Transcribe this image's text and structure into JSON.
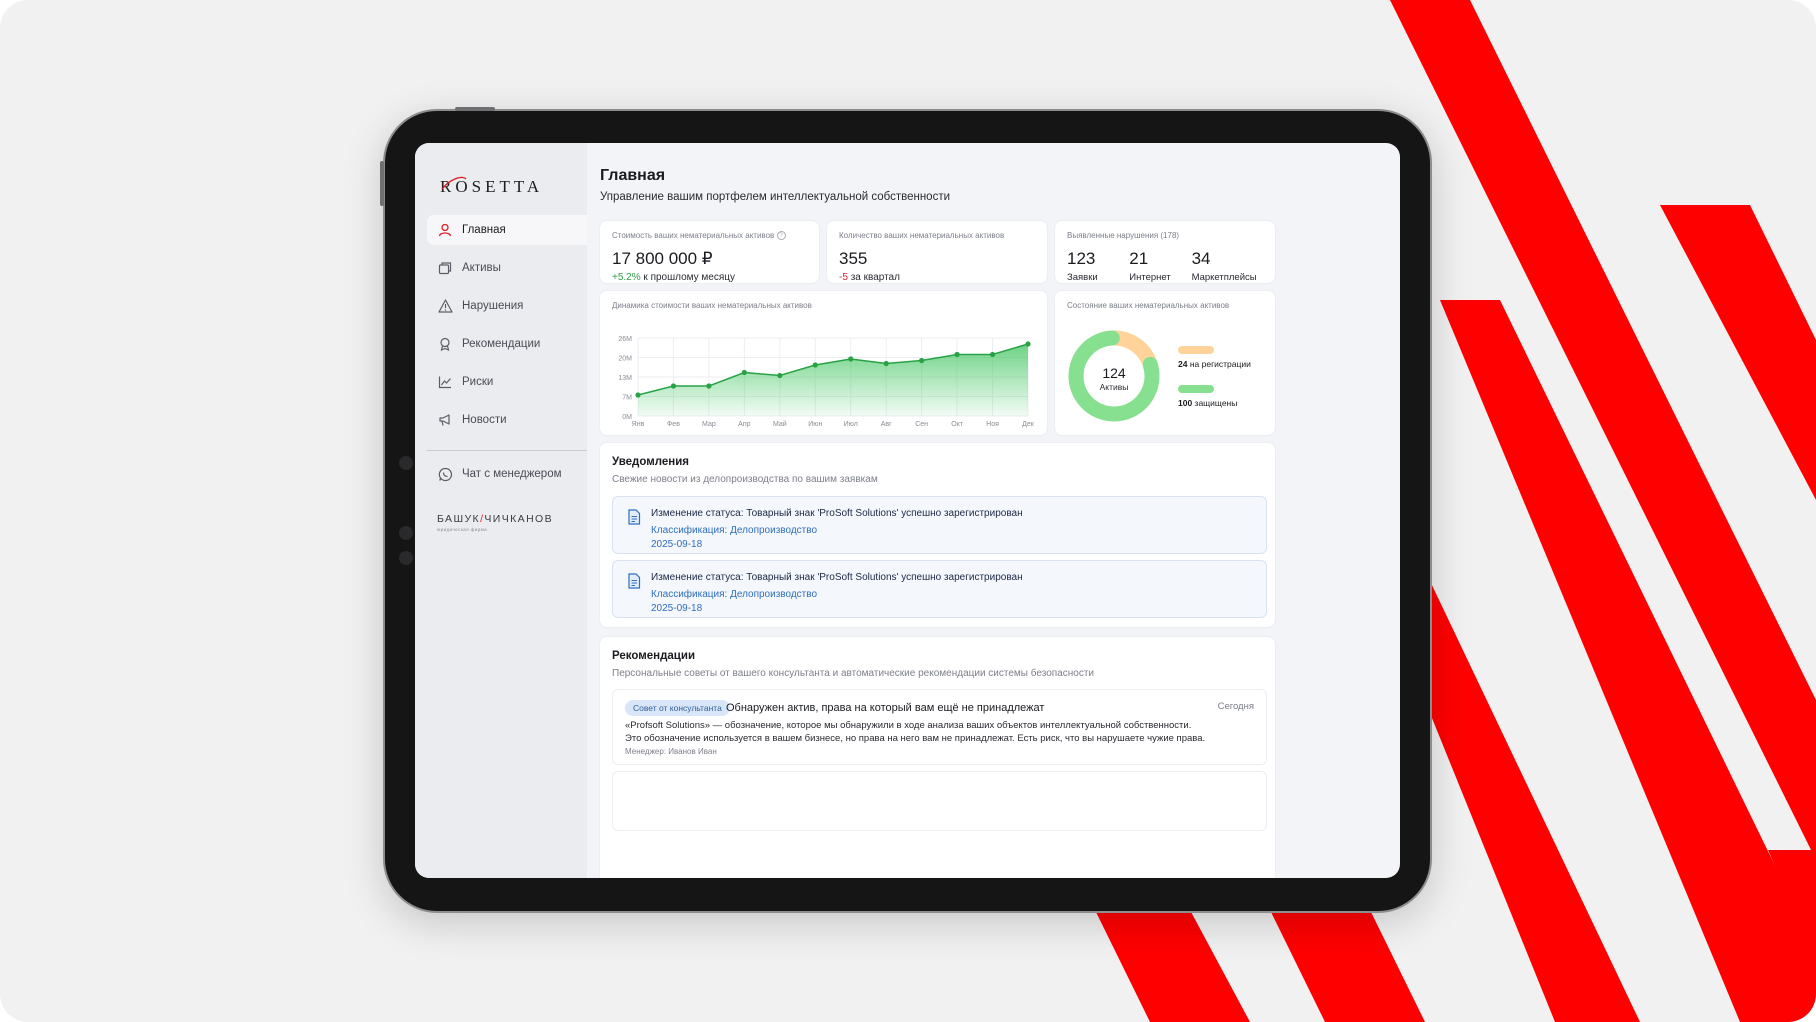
{
  "brand": {
    "logo": "ROSETTA",
    "partner_name_left": "БАШУК",
    "partner_slash": "/",
    "partner_name_right": "ЧИЧКАНОВ",
    "partner_sub": "юридическая фирма"
  },
  "sidebar": {
    "items": [
      {
        "label": "Главная",
        "icon": "user-icon",
        "active": true
      },
      {
        "label": "Активы",
        "icon": "stack-icon",
        "active": false
      },
      {
        "label": "Нарушения",
        "icon": "warning-icon",
        "active": false
      },
      {
        "label": "Рекомендации",
        "icon": "award-icon",
        "active": false
      },
      {
        "label": "Риски",
        "icon": "chart-line-icon",
        "active": false
      },
      {
        "label": "Новости",
        "icon": "megaphone-icon",
        "active": false
      }
    ],
    "chat_label": "Чат с менеджером"
  },
  "header": {
    "title": "Главная",
    "subtitle": "Управление вашим портфелем интеллектуальной собственности"
  },
  "kpis": {
    "value": {
      "label": "Стоимость ваших нематериальных активов",
      "amount": "17 800 000 ₽",
      "delta": "+5.2%",
      "delta_text": "к прошлому месяцу"
    },
    "count": {
      "label": "Количество ваших нематериальных активов",
      "amount": "355",
      "delta": "-5",
      "delta_text": "за квартал"
    },
    "violations": {
      "label": "Выявленные нарушения (178)",
      "items": [
        {
          "num": "123",
          "label": "Заявки"
        },
        {
          "num": "21",
          "label": "Интернет"
        },
        {
          "num": "34",
          "label": "Маркетплейсы"
        }
      ]
    }
  },
  "chart_data": [
    {
      "type": "area",
      "title": "Динамика стоимости ваших нематериальных активов",
      "categories": [
        "Янв",
        "Фев",
        "Мар",
        "Апр",
        "Май",
        "Июн",
        "Июл",
        "Авг",
        "Сен",
        "Окт",
        "Ноя",
        "Дек"
      ],
      "values": [
        7,
        10,
        10,
        14.5,
        13.5,
        17,
        19,
        17.5,
        18.5,
        20.5,
        20.5,
        24
      ],
      "y_ticks": [
        "0M",
        "7M",
        "13M",
        "20M",
        "26M"
      ],
      "ylim": [
        0,
        26
      ],
      "grid": true,
      "color": "#27a244"
    },
    {
      "type": "pie",
      "title": "Состояние ваших нематериальных активов",
      "center_value": "124",
      "center_label": "Активы",
      "slices": [
        {
          "value": 24,
          "label": "на регистрации",
          "color": "#ffd399"
        },
        {
          "value": 100,
          "label": "защищены",
          "color": "#86e08f"
        }
      ]
    }
  ],
  "notifications": {
    "title": "Уведомления",
    "subtitle": "Свежие новости из делопроизводства по вашим заявкам",
    "items": [
      {
        "title": "Изменение статуса: Товарный знак 'ProSoft Solutions' успешно зарегистрирован",
        "classification": "Классификация: Делопроизводство",
        "date": "2025-09-18"
      },
      {
        "title": "Изменение статуса: Товарный знак 'ProSoft Solutions' успешно зарегистрирован",
        "classification": "Классификация: Делопроизводство",
        "date": "2025-09-18"
      }
    ]
  },
  "recommendations": {
    "title": "Рекомендации",
    "subtitle": "Персональные советы от вашего консультанта и автоматические рекомендации системы безопасности",
    "items": [
      {
        "badge": "Совет от консультанта",
        "title": "Обнаружен актив, права на который вам ещё не принадлежат",
        "when": "Сегодня",
        "line1": "«Profsoft Solutions» — обозначение, которое мы обнаружили в ходе анализа ваших объектов интеллектуальной собственности.",
        "line2": "Это обозначение используется в вашем бизнесе, но права на него вам не принадлежат. Есть риск, что вы нарушаете чужие права.",
        "manager": "Менеджер: Иванов Иван"
      }
    ]
  },
  "colors": {
    "brand_red": "#ff0000",
    "accent_green": "#27a244",
    "link_blue": "#2e6fbe"
  }
}
